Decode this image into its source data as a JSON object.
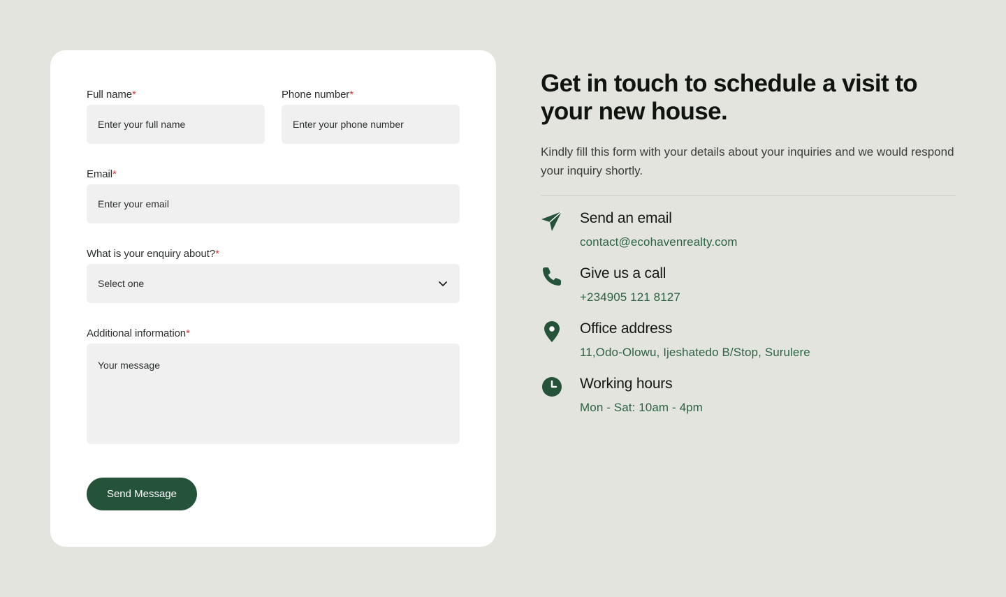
{
  "form": {
    "full_name": {
      "label": "Full name",
      "required_mark": "*",
      "placeholder": "Enter your full name",
      "value": ""
    },
    "phone": {
      "label": "Phone number",
      "required_mark": "*",
      "placeholder": "Enter your phone number",
      "value": ""
    },
    "email": {
      "label": "Email",
      "required_mark": "*",
      "placeholder": "Enter your email",
      "value": ""
    },
    "enquiry": {
      "label": "What is your enquiry about?",
      "required_mark": "*",
      "selected": "Select one"
    },
    "additional": {
      "label": "Additional information",
      "required_mark": "*",
      "placeholder": "Your message",
      "value": ""
    },
    "submit_label": "Send Message"
  },
  "info": {
    "headline": "Get in touch to schedule a visit to your new house.",
    "subtext": "Kindly fill this form with your details about your inquiries and we would respond your inquiry shortly.",
    "contacts": [
      {
        "icon": "send-icon",
        "title": "Send an email",
        "value": "contact@ecohavenrealty.com"
      },
      {
        "icon": "phone-icon",
        "title": "Give us a call",
        "value": "+234905 121 8127"
      },
      {
        "icon": "location-pin-icon",
        "title": "Office address",
        "value": "11,Odo-Olowu, Ijeshatedo B/Stop, Surulere"
      },
      {
        "icon": "clock-icon",
        "title": "Working hours",
        "value": "Mon - Sat: 10am - 4pm"
      }
    ]
  },
  "colors": {
    "background": "#e4e4df",
    "card": "#ffffff",
    "input_bg": "#f0f0f0",
    "accent": "#25533a",
    "link_green": "#2b6442",
    "required_red": "#e0393e"
  }
}
